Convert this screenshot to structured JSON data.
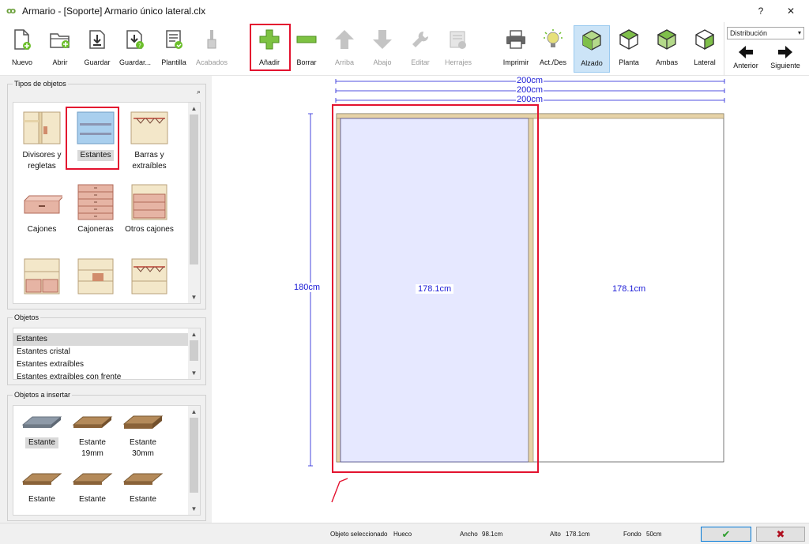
{
  "window": {
    "title": "Armario - [Soporte] Armario único lateral.clx",
    "help": "?",
    "close": "✕"
  },
  "toolbar": {
    "nuevo": "Nuevo",
    "abrir": "Abrir",
    "guardar": "Guardar",
    "guardar_como": "Guardar...",
    "plantilla": "Plantilla",
    "acabados": "Acabados",
    "anadir": "Añadir",
    "borrar": "Borrar",
    "arriba": "Arriba",
    "abajo": "Abajo",
    "editar": "Editar",
    "herrajes": "Herrajes",
    "imprimir": "Imprimir",
    "act_des": "Act./Des",
    "alzado": "Alzado",
    "planta": "Planta",
    "ambas": "Ambas",
    "lateral": "Lateral",
    "distribucion": "Distribución",
    "anterior": "Anterior",
    "siguiente": "Siguiente"
  },
  "tipos": {
    "title": "Tipos de objetos",
    "items": [
      "Divisores y regletas",
      "Estantes",
      "Barras y extraíbles",
      "Cajones",
      "Cajoneras",
      "Otros cajones"
    ]
  },
  "objetos": {
    "title": "Objetos",
    "items": [
      "Estantes",
      "Estantes cristal",
      "Estantes extraíbles",
      "Estantes extraíbles con frente"
    ]
  },
  "insertar": {
    "title": "Objetos a insertar",
    "items": [
      "Estante",
      "Estante 19mm",
      "Estante 30mm",
      "Estante",
      "Estante",
      "Estante"
    ]
  },
  "drawing": {
    "dim_top_1": "200cm",
    "dim_top_2": "200cm",
    "dim_top_3": "200cm",
    "dim_left": "180cm",
    "left_label": "178.1cm",
    "right_label": "178.1cm"
  },
  "status": {
    "obj_label": "Objeto seleccionado",
    "obj_value": "Hueco",
    "ancho_label": "Ancho",
    "ancho_value": "98.1cm",
    "alto_label": "Alto",
    "alto_value": "178.1cm",
    "fondo_label": "Fondo",
    "fondo_value": "50cm",
    "ok": "✔",
    "cancel": "✖"
  },
  "colors": {
    "accent_red": "#e3122f",
    "wood": "#e6d3a8",
    "green": "#6cbf2b",
    "dim_blue": "#1a1ad6"
  }
}
